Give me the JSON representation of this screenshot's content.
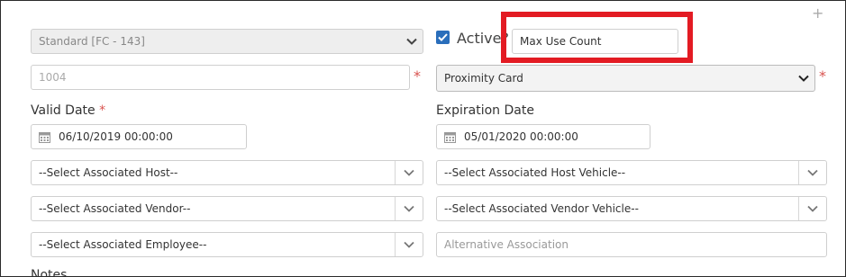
{
  "form": {
    "card_format": {
      "value": "Standard [FC - 143]"
    },
    "active": {
      "label": "Active?",
      "checked": true
    },
    "max_use_count": {
      "placeholder": "Max Use Count"
    },
    "card_number": {
      "value": "1004"
    },
    "card_type": {
      "value": "Proximity Card"
    },
    "valid_date": {
      "label": "Valid Date",
      "required_mark": "*",
      "value": "06/10/2019 00:00:00"
    },
    "expiration_date": {
      "label": "Expiration Date",
      "value": "05/01/2020 00:00:00"
    },
    "associated_host": {
      "value": "--Select Associated Host--"
    },
    "associated_host_vehicle": {
      "value": "--Select Associated Host Vehicle--"
    },
    "associated_vendor": {
      "value": "--Select Associated Vendor--"
    },
    "associated_vendor_vehicle": {
      "value": "--Select Associated Vendor Vehicle--"
    },
    "associated_employee": {
      "value": "--Select Associated Employee--"
    },
    "alternative_association": {
      "placeholder": "Alternative Association"
    },
    "notes_label": "Notes",
    "required_mark": "*",
    "add_symbol": "+"
  },
  "colors": {
    "highlight": "#e31b23",
    "checkbox": "#2a6ebb",
    "required": "#d9534f"
  },
  "icons": [
    "calendar-icon",
    "chevron-down-icon",
    "checkmark-icon",
    "plus-icon"
  ]
}
